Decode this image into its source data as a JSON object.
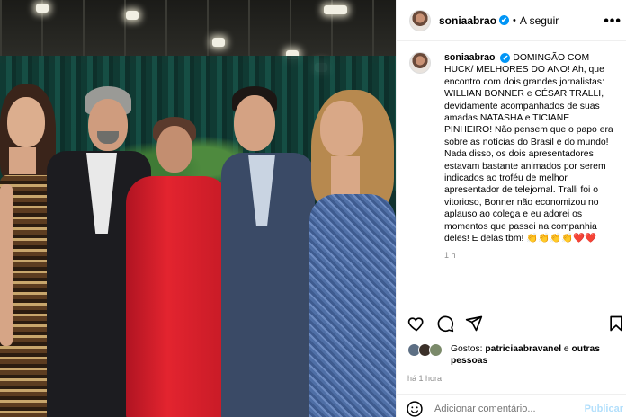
{
  "post": {
    "username": "soniaabrao",
    "verified_mark": "✔",
    "dot": "•",
    "follow_label": "A seguir",
    "more_label": "•••",
    "caption": "DOMINGÃO COM HUCK/ MELHORES DO ANO! Ah, que encontro com dois grandes jornalistas: WILLIAN BONNER e CÉSAR TRALLI, devidamente acompanhados de suas amadas NATASHA e TICIANE PINHEIRO! Não pensem que o papo era sobre as notícias do Brasil e do mundo! Nada disso, os dois apresentadores estavam bastante animados por serem indicados ao troféu de melhor apresentador de telejornal. Tralli foi o vitorioso, Bonner não economizou no aplauso ao colega e eu adorei os momentos que passei na companhia deles! E delas tbm! 👏👏👏👏❤️❤️",
    "caption_time": "1 h",
    "likes_prefix": "Gostos: ",
    "likes_user": "patriciaabravanel",
    "likes_connector": " e ",
    "likes_others": "outras pessoas",
    "posted_ago": "há 1 hora",
    "comment_placeholder": "Adicionar comentário...",
    "publish_label": "Publicar"
  },
  "icons": {
    "like": "heart-icon",
    "comment": "comment-icon",
    "share": "share-icon",
    "save": "bookmark-icon",
    "emoji": "emoji-icon",
    "more": "more-icon"
  },
  "colors": {
    "verified": "#0095f6",
    "muted": "#8e8e8e",
    "publish": "#b2dffc"
  }
}
